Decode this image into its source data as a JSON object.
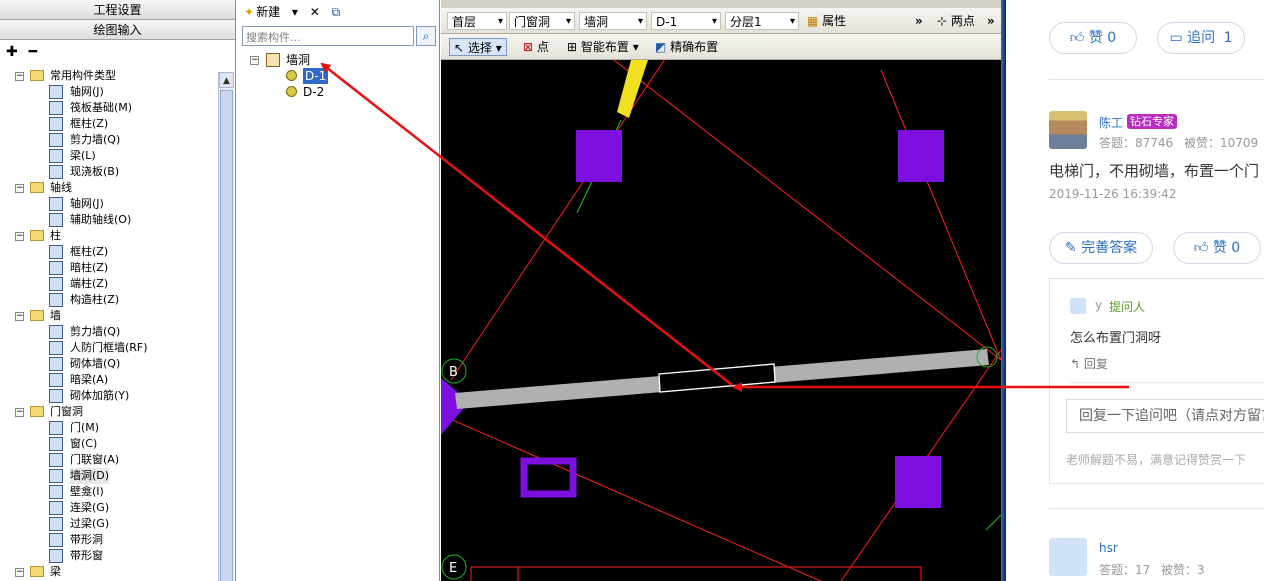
{
  "left_panel": {
    "header1": "工程设置",
    "header2": "绘图输入",
    "toolbar": {
      "expand": "✚",
      "collapse": "━"
    },
    "tree": [
      {
        "label": "常用构件类型",
        "level": 0,
        "type": "folder"
      },
      {
        "label": "轴网(J)",
        "level": 1,
        "type": "item"
      },
      {
        "label": "筏板基础(M)",
        "level": 1,
        "type": "item"
      },
      {
        "label": "框柱(Z)",
        "level": 1,
        "type": "item"
      },
      {
        "label": "剪力墙(Q)",
        "level": 1,
        "type": "item"
      },
      {
        "label": "梁(L)",
        "level": 1,
        "type": "item"
      },
      {
        "label": "现浇板(B)",
        "level": 1,
        "type": "item"
      },
      {
        "label": "轴线",
        "level": 0,
        "type": "folder"
      },
      {
        "label": "轴网(J)",
        "level": 1,
        "type": "item"
      },
      {
        "label": "辅助轴线(O)",
        "level": 1,
        "type": "item"
      },
      {
        "label": "柱",
        "level": 0,
        "type": "folder"
      },
      {
        "label": "框柱(Z)",
        "level": 1,
        "type": "item"
      },
      {
        "label": "暗柱(Z)",
        "level": 1,
        "type": "item"
      },
      {
        "label": "端柱(Z)",
        "level": 1,
        "type": "item"
      },
      {
        "label": "构造柱(Z)",
        "level": 1,
        "type": "item"
      },
      {
        "label": "墙",
        "level": 0,
        "type": "folder"
      },
      {
        "label": "剪力墙(Q)",
        "level": 1,
        "type": "item"
      },
      {
        "label": "人防门框墙(RF)",
        "level": 1,
        "type": "item"
      },
      {
        "label": "砌体墙(Q)",
        "level": 1,
        "type": "item"
      },
      {
        "label": "暗梁(A)",
        "level": 1,
        "type": "item"
      },
      {
        "label": "砌体加筋(Y)",
        "level": 1,
        "type": "item"
      },
      {
        "label": "门窗洞",
        "level": 0,
        "type": "folder"
      },
      {
        "label": "门(M)",
        "level": 1,
        "type": "item"
      },
      {
        "label": "窗(C)",
        "level": 1,
        "type": "item"
      },
      {
        "label": "门联窗(A)",
        "level": 1,
        "type": "item"
      },
      {
        "label": "墙洞(D)",
        "level": 1,
        "type": "item",
        "selected": true
      },
      {
        "label": "壁龛(I)",
        "level": 1,
        "type": "item"
      },
      {
        "label": "连梁(G)",
        "level": 1,
        "type": "item"
      },
      {
        "label": "过梁(G)",
        "level": 1,
        "type": "item"
      },
      {
        "label": "带形洞",
        "level": 1,
        "type": "item"
      },
      {
        "label": "带形窗",
        "level": 1,
        "type": "item"
      },
      {
        "label": "梁",
        "level": 0,
        "type": "folder"
      }
    ]
  },
  "mid_panel": {
    "new_label": "新建",
    "delete_icon": "✕",
    "copy_icon": "⧉",
    "search_placeholder": "搜索构件...",
    "tree": [
      {
        "label": "墙洞",
        "level": 0
      },
      {
        "label": "D-1",
        "level": 1,
        "selected": true
      },
      {
        "label": "D-2",
        "level": 1
      }
    ]
  },
  "cad_toolbar": {
    "floor": "首层",
    "category": "门窗洞",
    "type": "墙洞",
    "component": "D-1",
    "layer": "分层1",
    "properties": "属性",
    "two_point": "两点",
    "select": "选择",
    "point": "点",
    "smart_place": "智能布置",
    "precise_place": "精确布置"
  },
  "cad": {
    "axis_labels": [
      "B",
      "E"
    ],
    "colors": {
      "background": "#000000",
      "column": "#7b10e0",
      "wall": "#b0b0b0",
      "gridline": "#ff2020",
      "annotation_arrow": "#e81010",
      "yellow_beam": "#f0e020"
    }
  },
  "qa": {
    "like_top": "赞 0",
    "ask_top": "追问",
    "ask_count": "1",
    "expert_name": "陈工",
    "expert_badge": "钻石专家",
    "expert_answers": "答题：87746",
    "expert_liked": "被赞：10709",
    "answer_text": "电梯门，不用砌墙，布置一个门",
    "answer_time": "2019-11-26 16:39:42",
    "improve_label": "完善答案",
    "like_label": "赞 0",
    "asker_name": "y",
    "asker_role": "提问人",
    "question": "怎么布置门洞呀",
    "reply_label": "回复",
    "reply_placeholder": "回复一下追问吧（请点对方留言",
    "hint": "老师解题不易，满意记得赞赏一下",
    "next_user": "hsr",
    "next_answers": "答题：17",
    "next_liked": "被赞：3"
  }
}
